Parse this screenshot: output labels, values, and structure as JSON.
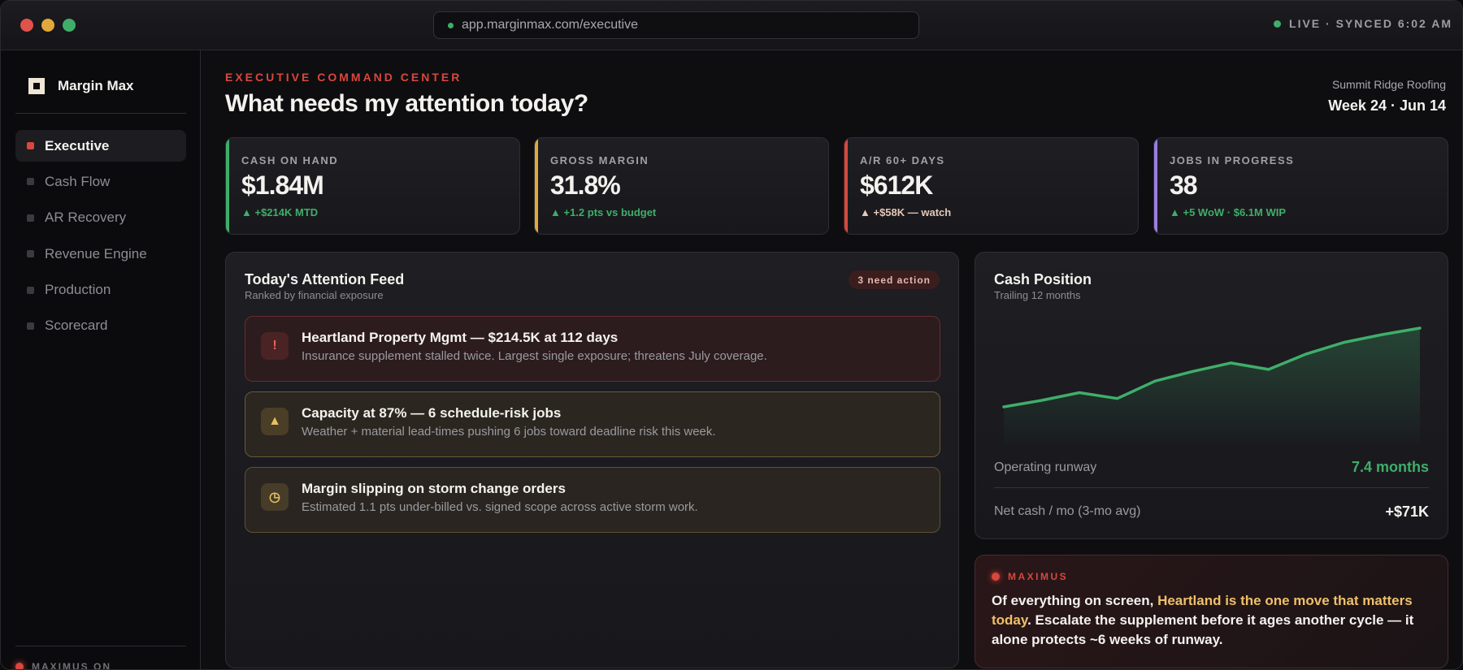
{
  "browser": {
    "url": "app.marginmax.com/executive",
    "status": "LIVE · SYNCED 6:02 AM"
  },
  "sidebar": {
    "brand": "Margin Max",
    "items": [
      {
        "label": "Executive",
        "active": true
      },
      {
        "label": "Cash Flow",
        "active": false
      },
      {
        "label": "AR Recovery",
        "active": false
      },
      {
        "label": "Revenue Engine",
        "active": false
      },
      {
        "label": "Production",
        "active": false
      },
      {
        "label": "Scorecard",
        "active": false
      }
    ],
    "footer": "MAXIMUS ON"
  },
  "header": {
    "eyebrow": "EXECUTIVE COMMAND CENTER",
    "title": "What needs my attention today?",
    "company": "Summit Ridge Roofing",
    "period": "Week 24 · Jun 14"
  },
  "kpis": [
    {
      "label": "CASH ON HAND",
      "value": "$1.84M",
      "delta": "▲ +$214K MTD",
      "color": "#3fae6a"
    },
    {
      "label": "GROSS MARGIN",
      "value": "31.8%",
      "delta": "▲ +1.2 pts vs budget",
      "color": "#e0a93a"
    },
    {
      "label": "A/R 60+ DAYS",
      "value": "$612K",
      "delta": "▲ +$58K — watch",
      "color": "#d9473d"
    },
    {
      "label": "JOBS IN PROGRESS",
      "value": "38",
      "delta": "▲ +5 WoW · $6.1M WIP",
      "color": "#9a7ee0"
    }
  ],
  "feed": {
    "title": "Today's Attention Feed",
    "subtitle": "Ranked by financial exposure",
    "badge": "3 need action",
    "alerts": [
      {
        "icon": "!",
        "icon_name": "alert-icon",
        "title": "Heartland Property Mgmt — $214.5K at 112 days",
        "desc": "Insurance supplement stalled twice. Largest single exposure; threatens July coverage."
      },
      {
        "icon": "▲",
        "icon_name": "warning-icon",
        "title": "Capacity at 87% — 6 schedule-risk jobs",
        "desc": "Weather + material lead-times pushing 6 jobs toward deadline risk this week."
      },
      {
        "icon": "◷",
        "icon_name": "clock-icon",
        "title": "Margin slipping on storm change orders",
        "desc": "Estimated 1.1 pts under-billed vs. signed scope across active storm work."
      }
    ]
  },
  "cash": {
    "title": "Cash Position",
    "subtitle": "Trailing 12 months",
    "runway_label": "Operating runway",
    "runway_value": "7.4 months",
    "runway_color": "#3fae6a",
    "netcash_label": "Net cash / mo (3-mo avg)",
    "netcash_value": "+$71K"
  },
  "chart_data": {
    "type": "area",
    "title": "Cash Position",
    "subtitle": "Trailing 12 months",
    "series": [
      {
        "values": [
          1.0,
          1.1,
          1.22,
          1.13,
          1.4,
          1.55,
          1.68,
          1.58,
          1.82,
          2.0,
          2.12,
          2.22
        ]
      }
    ],
    "color": "#3fae6a"
  },
  "maximus": {
    "label": "MAXIMUS",
    "msg_start": "Of everything on screen, ",
    "msg_highlight": "Heartland is the one move that matters today",
    "msg_end": ". Escalate the supplement before it ages another cycle — it alone protects ~6 weeks of runway."
  }
}
